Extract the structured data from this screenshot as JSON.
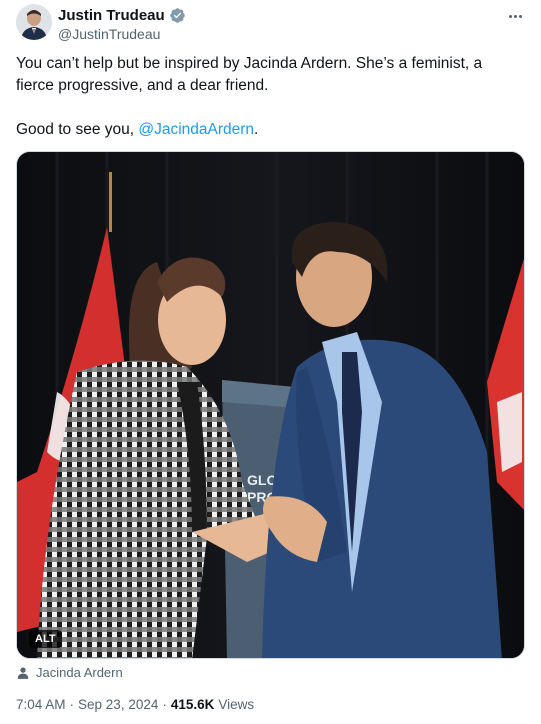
{
  "author": {
    "display_name": "Justin Trudeau",
    "handle": "@JustinTrudeau",
    "verified": true
  },
  "tweet": {
    "line1": "You can’t help but be inspired by Jacinda Ardern. She’s a feminist, a fierce progressive, and a dear friend.",
    "line2_prefix": "Good to see you, ",
    "line2_mention": "@JacindaArdern",
    "line2_suffix": "."
  },
  "media": {
    "alt_badge": "ALT",
    "banner_line1": "GLOBAL",
    "banner_line2": "PROGRESS"
  },
  "tagged_person": "Jacinda Ardern",
  "meta": {
    "time": "7:04 AM",
    "separator": "·",
    "date": "Sep 23, 2024",
    "views_count": "415.6K",
    "views_label": "Views"
  },
  "colors": {
    "link": "#1d9bf0",
    "verified": "#829aab",
    "secondary_text": "#536471"
  }
}
